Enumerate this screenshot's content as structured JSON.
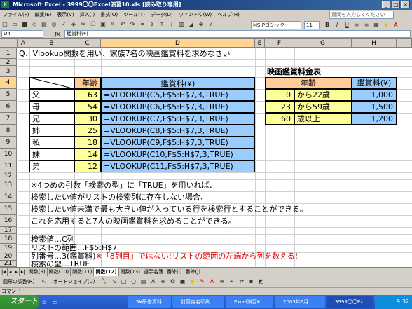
{
  "window": {
    "title": "Microsoft Excel - 3999〇〇Excel演習10.xls [読み取り専用]"
  },
  "menu": [
    "ファイル(F)",
    "編集(E)",
    "表示(V)",
    "挿入(I)",
    "書式(O)",
    "ツール(T)",
    "データ(D)",
    "ウィンドウ(W)",
    "ヘルプ(H)"
  ],
  "help_placeholder": "質問を入力してください",
  "font": {
    "name": "MS Pゴシック",
    "size": "11"
  },
  "formula_bar": {
    "name_box": "D4",
    "formula": "鑑賞料(¥)"
  },
  "columns": [
    "A",
    "B",
    "C",
    "D",
    "E",
    "F",
    "G",
    "H"
  ],
  "rows": [
    "1",
    "2",
    "3",
    "4",
    "5",
    "6",
    "7",
    "8",
    "9",
    "10",
    "11",
    "12",
    "13",
    "14",
    "15",
    "16",
    "17",
    "18",
    "19",
    "20",
    "21"
  ],
  "sheet": {
    "title": "Q．Vlookup関数を用い、家族7名の映画鑑賞料を求めなさい",
    "table_header": {
      "age": "年齢",
      "fee": "鑑賞料(¥)"
    },
    "family": [
      {
        "name": "父",
        "age": "63",
        "formula": "=VLOOKUP(C5,F$5:H$7,3,TRUE)"
      },
      {
        "name": "母",
        "age": "54",
        "formula": "=VLOOKUP(C6,F$5:H$7,3,TRUE)"
      },
      {
        "name": "兄",
        "age": "30",
        "formula": "=VLOOKUP(C7,F$5:H$7,3,TRUE)"
      },
      {
        "name": "姉",
        "age": "25",
        "formula": "=VLOOKUP(C8,F$5:H$7,3,TRUE)"
      },
      {
        "name": "私",
        "age": "18",
        "formula": "=VLOOKUP(C9,F$5:H$7,3,TRUE)"
      },
      {
        "name": "妹",
        "age": "14",
        "formula": "=VLOOKUP(C10,F$5:H$7,3,TRUE)"
      },
      {
        "name": "弟",
        "age": "12",
        "formula": "=VLOOKUP(C11,F$5:H$7,3,TRUE)"
      }
    ],
    "price_title": "映画鑑賞料金表",
    "price_header": {
      "age": "年齢",
      "fee": "鑑賞料(¥)"
    },
    "price_table": [
      {
        "age": "0",
        "range": "から22歳",
        "fee": "1,000"
      },
      {
        "age": "23",
        "range": "から59歳",
        "fee": "1,500"
      },
      {
        "age": "60",
        "range": "歳以上",
        "fee": "1,200"
      }
    ],
    "notes": [
      "※4つめの引数「検索の型」に「TRUE」を用いれば、",
      "検索したい値がリストの検索列に存在しない場合、",
      "検索したい値未満で最も大きい値が入っている行を検索行とすることができる。",
      "これを応用すると7人の映画鑑賞料を求めることができる。"
    ],
    "lookup_value": "検索値…C列",
    "list_range": "リストの範囲…F$5:H$7",
    "col_index_prefix": "列番号…3(鑑賞料)",
    "col_index_note": "※「8列目」ではない!リストの範囲の左端から列を数える!",
    "lookup_type": "検索の型…TRUE"
  },
  "sheet_tabs": [
    "関数(9)",
    "関数(10)",
    "関数(11)",
    "関数(12)",
    "関数(13)",
    "選手名簿",
    "番外(I)",
    "番外(J)"
  ],
  "active_tab_index": 3,
  "drawing_toolbar": {
    "draw": "図形の調整(R)",
    "autoshape": "オートシェイプ(U)"
  },
  "status": "コマンド",
  "taskbar": {
    "start": "スタート",
    "items": [
      "S¥研修資料",
      "封筒宛名印刷...",
      "Excel演習¥",
      "2005年6月...",
      "3999〇〇Ex..."
    ],
    "active_index": 4,
    "clock": "9:32"
  }
}
